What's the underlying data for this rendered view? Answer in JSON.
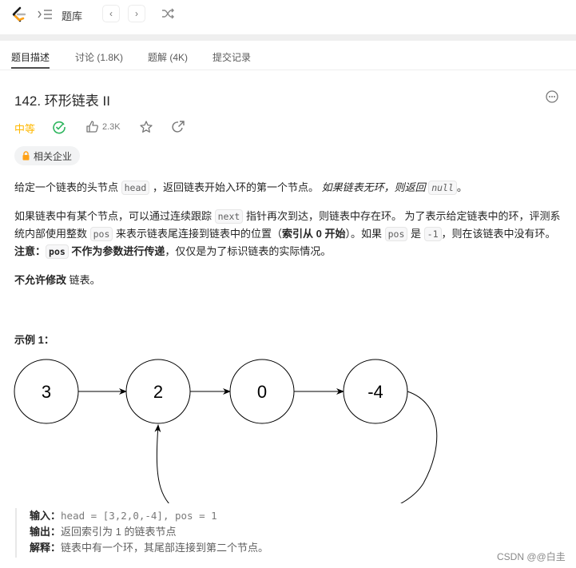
{
  "topbar": {
    "logo": "leetcode-logo-icon",
    "problem_list_label": "题库",
    "prev_icon": "chevron-left-icon",
    "next_icon": "chevron-right-icon",
    "random_icon": "shuffle-icon"
  },
  "tabs": [
    {
      "label": "题目描述",
      "active": true
    },
    {
      "label": "讨论 (1.8K)",
      "active": false
    },
    {
      "label": "题解 (4K)",
      "active": false
    },
    {
      "label": "提交记录",
      "active": false
    }
  ],
  "problem": {
    "number_title": "142. 环形链表 II",
    "difficulty": "中等",
    "difficulty_color": "#ffb800",
    "solved_color": "#2db55d",
    "likes": "2.3K",
    "companies_label": "相关企业",
    "lock_color": "#ffa116"
  },
  "description": {
    "p1": {
      "t1": "给定一个链表的头节点 ",
      "c1": "head",
      "t2": " ，返回链表开始入环的第一个节点。 ",
      "i1": "如果链表无环，则返回 ",
      "c2": "null",
      "t3": "。"
    },
    "p2": {
      "t1": "如果链表中有某个节点，可以通过连续跟踪 ",
      "c1": "next",
      "t2": " 指针再次到达，则链表中存在环。 为了表示给定链表中的环，评测系统内部使用整数 ",
      "c2": "pos",
      "t3": " 来表示链表尾连接到链表中的位置（",
      "b1": "索引从 0 开始",
      "t4": "）。如果 ",
      "c3": "pos",
      "t5": " 是 ",
      "c4": "-1",
      "t6": "，则在该链表中没有环。",
      "b2": "注意：",
      "c5": "pos",
      "b3": " 不作为参数进行传递",
      "t7": "，仅仅是为了标识链表的实际情况。"
    },
    "p3": {
      "b1": "不允许修改",
      "t1": " 链表。"
    }
  },
  "example": {
    "title": "示例 1：",
    "nodes": [
      "3",
      "2",
      "0",
      "-4"
    ],
    "cycle_from_index": 3,
    "cycle_to_index": 1,
    "input_label": "输入：",
    "input_value": "head = [3,2,0,-4], pos = 1",
    "output_label": "输出：",
    "output_value": "返回索引为 1 的链表节点",
    "explain_label": "解释：",
    "explain_value": "链表中有一个环，其尾部连接到第二个节点。"
  },
  "watermark": "CSDN @@白圭"
}
